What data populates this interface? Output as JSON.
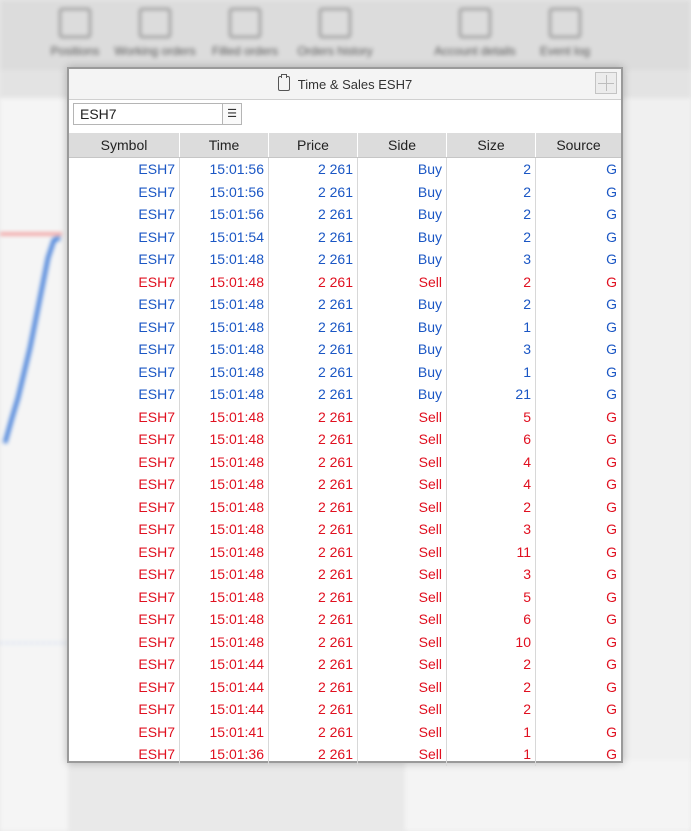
{
  "background": {
    "toolbar": [
      "Positions",
      "Working orders",
      "Filled orders",
      "Orders history",
      "Account details",
      "Event log"
    ]
  },
  "window": {
    "title": "Time & Sales ESH7",
    "symbol_input": "ESH7"
  },
  "table": {
    "columns": [
      "Symbol",
      "Time",
      "Price",
      "Side",
      "Size",
      "Source"
    ],
    "rows": [
      [
        "ESH7",
        "15:01:56",
        "2 261",
        "Buy",
        "2",
        "G"
      ],
      [
        "ESH7",
        "15:01:56",
        "2 261",
        "Buy",
        "2",
        "G"
      ],
      [
        "ESH7",
        "15:01:56",
        "2 261",
        "Buy",
        "2",
        "G"
      ],
      [
        "ESH7",
        "15:01:54",
        "2 261",
        "Buy",
        "2",
        "G"
      ],
      [
        "ESH7",
        "15:01:48",
        "2 261",
        "Buy",
        "3",
        "G"
      ],
      [
        "ESH7",
        "15:01:48",
        "2 261",
        "Sell",
        "2",
        "G"
      ],
      [
        "ESH7",
        "15:01:48",
        "2 261",
        "Buy",
        "2",
        "G"
      ],
      [
        "ESH7",
        "15:01:48",
        "2 261",
        "Buy",
        "1",
        "G"
      ],
      [
        "ESH7",
        "15:01:48",
        "2 261",
        "Buy",
        "3",
        "G"
      ],
      [
        "ESH7",
        "15:01:48",
        "2 261",
        "Buy",
        "1",
        "G"
      ],
      [
        "ESH7",
        "15:01:48",
        "2 261",
        "Buy",
        "21",
        "G"
      ],
      [
        "ESH7",
        "15:01:48",
        "2 261",
        "Sell",
        "5",
        "G"
      ],
      [
        "ESH7",
        "15:01:48",
        "2 261",
        "Sell",
        "6",
        "G"
      ],
      [
        "ESH7",
        "15:01:48",
        "2 261",
        "Sell",
        "4",
        "G"
      ],
      [
        "ESH7",
        "15:01:48",
        "2 261",
        "Sell",
        "4",
        "G"
      ],
      [
        "ESH7",
        "15:01:48",
        "2 261",
        "Sell",
        "2",
        "G"
      ],
      [
        "ESH7",
        "15:01:48",
        "2 261",
        "Sell",
        "3",
        "G"
      ],
      [
        "ESH7",
        "15:01:48",
        "2 261",
        "Sell",
        "11",
        "G"
      ],
      [
        "ESH7",
        "15:01:48",
        "2 261",
        "Sell",
        "3",
        "G"
      ],
      [
        "ESH7",
        "15:01:48",
        "2 261",
        "Sell",
        "5",
        "G"
      ],
      [
        "ESH7",
        "15:01:48",
        "2 261",
        "Sell",
        "6",
        "G"
      ],
      [
        "ESH7",
        "15:01:48",
        "2 261",
        "Sell",
        "10",
        "G"
      ],
      [
        "ESH7",
        "15:01:44",
        "2 261",
        "Sell",
        "2",
        "G"
      ],
      [
        "ESH7",
        "15:01:44",
        "2 261",
        "Sell",
        "2",
        "G"
      ],
      [
        "ESH7",
        "15:01:44",
        "2 261",
        "Sell",
        "2",
        "G"
      ],
      [
        "ESH7",
        "15:01:41",
        "2 261",
        "Sell",
        "1",
        "G"
      ],
      [
        "ESH7",
        "15:01:36",
        "2 261",
        "Sell",
        "1",
        "G"
      ]
    ]
  },
  "colors": {
    "buy": "#1a56c4",
    "sell": "#e00f1f"
  }
}
